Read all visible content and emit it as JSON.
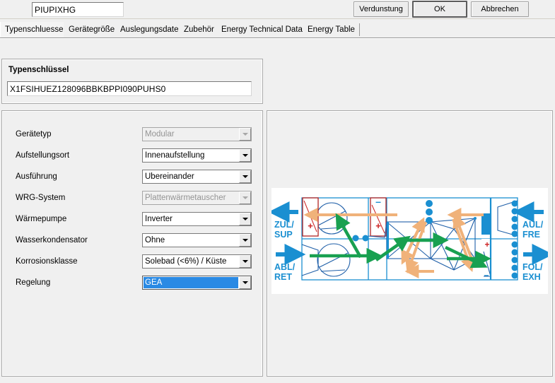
{
  "window": {
    "buttons": [
      {
        "id": "verdunstung",
        "label": "Verdunstung",
        "default": false
      },
      {
        "id": "ok",
        "label": "OK",
        "default": true
      },
      {
        "id": "abbrechen",
        "label": "Abbrechen",
        "default": false
      }
    ]
  },
  "tabs": [
    {
      "label": "Typenschluessel",
      "selected": true
    },
    {
      "label": "Gerätegröße",
      "selected": false
    },
    {
      "label": "Auslegungsdaten",
      "selected": false
    },
    {
      "label": "Zubehör",
      "selected": false
    },
    {
      "label": "Energy Technical Data",
      "selected": false
    },
    {
      "label": "Energy Table",
      "selected": false
    }
  ],
  "typenschluessel": {
    "title": "Typenschlüssel",
    "code": "X1FSIHUEZ128096BBKBPPI090PUHS0",
    "placeholder": ""
  },
  "right_code": {
    "value": "PIUPIXHG",
    "placeholder": ""
  },
  "form": {
    "rows": [
      {
        "label": "Gerätetyp",
        "value": "Modular",
        "state": "disabled"
      },
      {
        "label": "Aufstellungsort",
        "value": "Innenaufstellung",
        "state": "enabled"
      },
      {
        "label": "Ausführung",
        "value": "Übereinander",
        "state": "enabled"
      },
      {
        "label": "WRG-System",
        "value": "Plattenwärmetauscher",
        "state": "disabled"
      },
      {
        "label": "Wärmepumpe",
        "value": "Inverter",
        "state": "enabled"
      },
      {
        "label": "Wasserkondensator",
        "value": "Ohne",
        "state": "enabled"
      },
      {
        "label": "Korrosionsklasse",
        "value": "Solebad (<6%) / Küste",
        "state": "enabled"
      },
      {
        "label": "Regelung",
        "value": "GEA",
        "state": "focused"
      }
    ]
  },
  "diagram": {
    "labels": {
      "supply_top": "ZUL/",
      "supply_bottom": "SUP",
      "return_top": "ABL/",
      "return_bottom": "RET",
      "outdoor_top": "AUL/",
      "outdoor_bottom": "FRE",
      "exhaust_top": "FOL/",
      "exhaust_bottom": "EXH"
    },
    "colors": {
      "blue": "#1a8fd1",
      "dark_blue": "#1f5fa8",
      "green": "#18a050",
      "orange": "#f0b27a",
      "red": "#cc2222"
    },
    "coil_signs": [
      "+",
      "-",
      "+",
      "+",
      "-"
    ]
  }
}
